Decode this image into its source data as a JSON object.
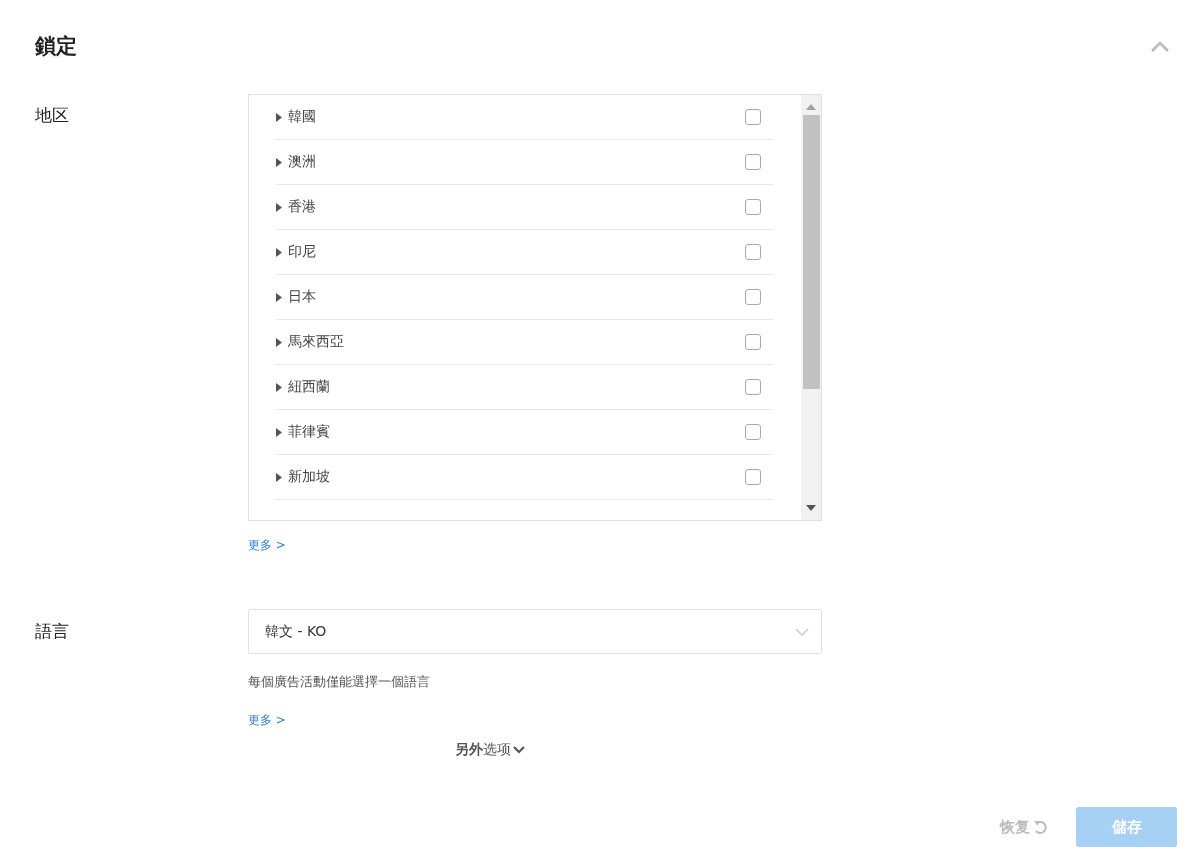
{
  "section": {
    "title": "鎖定",
    "expanded": true
  },
  "region": {
    "label": "地区",
    "items": [
      {
        "name": "韓國",
        "checked": false,
        "expanded": false
      },
      {
        "name": "澳洲",
        "checked": false,
        "expanded": false
      },
      {
        "name": "香港",
        "checked": false,
        "expanded": false
      },
      {
        "name": "印尼",
        "checked": false,
        "expanded": false
      },
      {
        "name": "日本",
        "checked": false,
        "expanded": false
      },
      {
        "name": "馬來西亞",
        "checked": false,
        "expanded": false
      },
      {
        "name": "紐西蘭",
        "checked": false,
        "expanded": false
      },
      {
        "name": "菲律賓",
        "checked": false,
        "expanded": false
      },
      {
        "name": "新加坡",
        "checked": false,
        "expanded": false
      }
    ],
    "more": "更多 >"
  },
  "language": {
    "label": "語言",
    "value": "韓文 - KO",
    "hint": "每個廣告活動僅能選擇一個語言",
    "more": "更多 >"
  },
  "extra_options": {
    "label_bold": "另外",
    "label": "选项",
    "expanded": false
  },
  "actions": {
    "restore": {
      "label": "恢复",
      "disabled": true
    },
    "save": {
      "label": "儲存",
      "disabled": true
    }
  }
}
